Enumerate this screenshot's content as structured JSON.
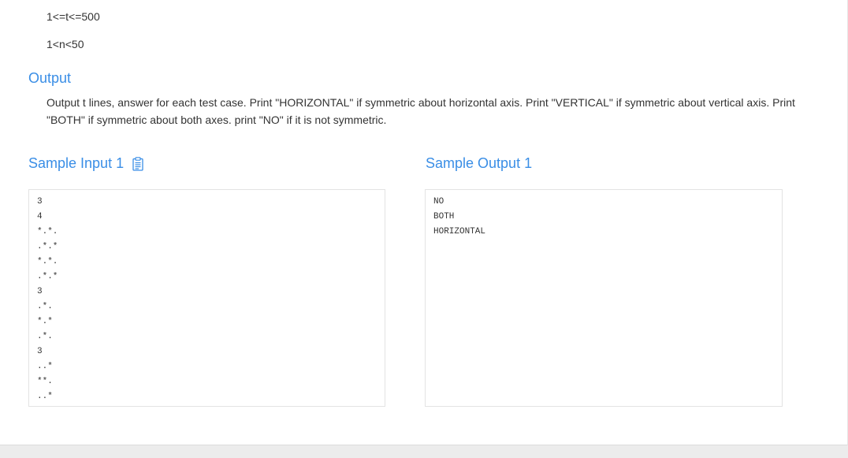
{
  "constraints": [
    "1<=t<=500",
    "1<n<50"
  ],
  "output_section": {
    "heading": "Output",
    "text": "Output t lines, answer for each test case. Print \"HORIZONTAL\" if symmetric about horizontal axis. Print \"VERTICAL\" if symmetric about vertical axis. Print \"BOTH\" if symmetric about both axes. print \"NO\" if it is not symmetric."
  },
  "sample_input": {
    "heading": "Sample Input 1",
    "copy_icon": "clipboard-icon",
    "content": "3\n4\n*.*.\n.*.*\n*.*.\n.*.*\n3\n.*.\n*.*\n.*.\n3\n..*\n**.\n..*"
  },
  "sample_output": {
    "heading": "Sample Output 1",
    "content": "NO\nBOTH\nHORIZONTAL"
  },
  "colors": {
    "heading_blue": "#3a8ee6",
    "text": "#333333",
    "border": "#e3e3e3",
    "page_bg": "#ececec"
  }
}
